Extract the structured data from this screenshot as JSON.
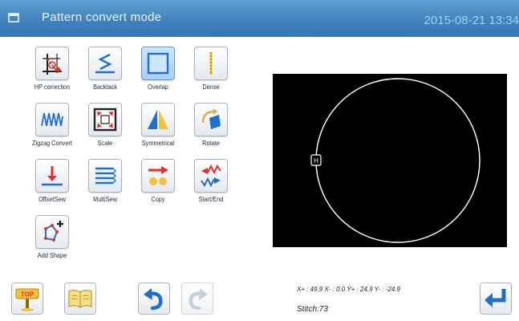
{
  "header": {
    "title": "Pattern convert mode",
    "datetime": "2015-08-21 13:34",
    "menu_icon": "window-icon"
  },
  "tools": [
    {
      "id": "hp-correction",
      "label": "HP correction",
      "icon": "hp-correction-icon",
      "selected": false
    },
    {
      "id": "backtack",
      "label": "Backtack",
      "icon": "backtack-icon",
      "selected": false
    },
    {
      "id": "overlap",
      "label": "Overlap",
      "icon": "overlap-icon",
      "selected": true
    },
    {
      "id": "dense",
      "label": "Dense",
      "icon": "dense-icon",
      "selected": false
    },
    {
      "id": "zigzag-convert",
      "label": "Zigzag Convert",
      "icon": "zigzag-icon",
      "selected": false
    },
    {
      "id": "scale",
      "label": "Scale",
      "icon": "scale-icon",
      "selected": false
    },
    {
      "id": "symmetrical",
      "label": "Symmetrical",
      "icon": "symmetrical-icon",
      "selected": false
    },
    {
      "id": "rotate",
      "label": "Rotate",
      "icon": "rotate-icon",
      "selected": false
    },
    {
      "id": "offsetsew",
      "label": "OffsetSew",
      "icon": "offset-sew-icon",
      "selected": false
    },
    {
      "id": "multisew",
      "label": "MultiSew",
      "icon": "multi-sew-icon",
      "selected": false
    },
    {
      "id": "copy",
      "label": "Copy",
      "icon": "copy-icon",
      "selected": false
    },
    {
      "id": "start-end",
      "label": "Start/End",
      "icon": "start-end-icon",
      "selected": false
    },
    {
      "id": "add-shape",
      "label": "Add Shape",
      "icon": "add-shape-icon",
      "selected": false
    }
  ],
  "preview": {
    "shape": "circle",
    "start_marker": "H",
    "background": "#000000",
    "stroke": "#ffffff"
  },
  "status": {
    "coords": "X+ : 49.9  X- : 0.0  Y+ : 24.9  Y- : -24.9",
    "stitch": "Stitch:73"
  },
  "bottom_buttons": [
    {
      "id": "top",
      "label": "TOP",
      "icon": "top-sign-icon",
      "enabled": true
    },
    {
      "id": "book",
      "icon": "book-icon",
      "enabled": true
    },
    {
      "id": "undo",
      "icon": "undo-icon",
      "enabled": true
    },
    {
      "id": "redo",
      "icon": "redo-icon",
      "enabled": false
    },
    {
      "id": "enter",
      "icon": "enter-return-icon",
      "enabled": true
    }
  ],
  "colors": {
    "titlebar": "#3f80bd",
    "accent_blue": "#1e6fd0",
    "accent_red": "#e0302a",
    "selected_button": "#a9cff2"
  }
}
